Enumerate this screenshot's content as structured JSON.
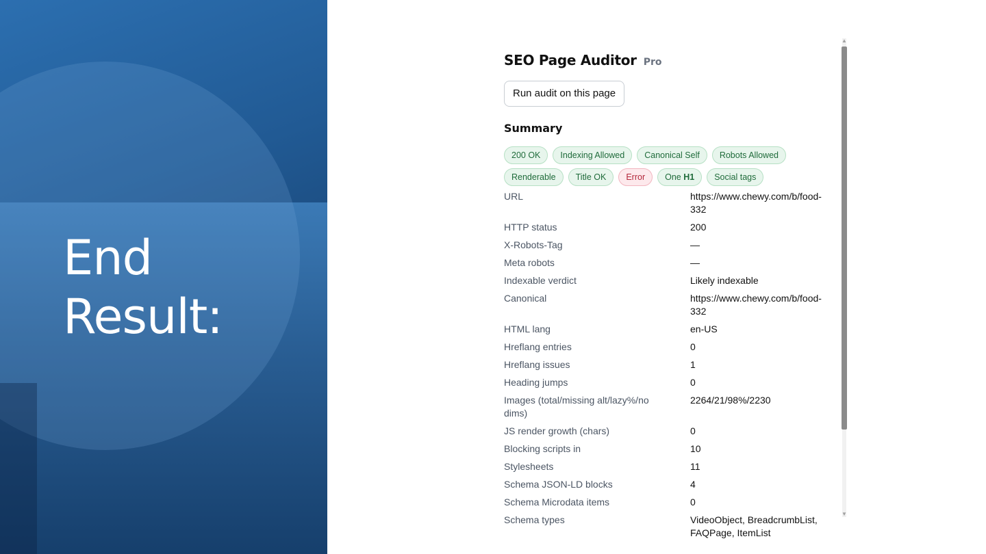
{
  "slide": {
    "title_line1": "End",
    "title_line2": "Result:"
  },
  "extension": {
    "app_name": "SEO Page Auditor",
    "badge": "Pro",
    "run_button_label": "Run audit on this page",
    "summary_heading": "Summary",
    "chips": [
      {
        "label": "200 OK",
        "status": "ok"
      },
      {
        "label": "Indexing Allowed",
        "status": "ok"
      },
      {
        "label": "Canonical Self",
        "status": "ok"
      },
      {
        "label": "Robots Allowed",
        "status": "ok"
      },
      {
        "label": "Renderable",
        "status": "ok"
      },
      {
        "label": "Title OK",
        "status": "ok"
      },
      {
        "label": "Error",
        "status": "error"
      },
      {
        "label_prefix": "One ",
        "label_bold": "H1",
        "status": "ok"
      },
      {
        "label": "Social tags",
        "status": "ok"
      }
    ],
    "rows": [
      {
        "key": "URL",
        "value": "https://www.chewy.com/b/food-332"
      },
      {
        "key": "HTTP status",
        "value": "200"
      },
      {
        "key": "X-Robots-Tag",
        "value": "—"
      },
      {
        "key": "Meta robots",
        "value": "—"
      },
      {
        "key": "Indexable verdict",
        "value": "Likely indexable"
      },
      {
        "key": "Canonical",
        "value": "https://www.chewy.com/b/food-332"
      },
      {
        "key": "HTML lang",
        "value": "en-US"
      },
      {
        "key": "Hreflang entries",
        "value": "0"
      },
      {
        "key": "Hreflang issues",
        "value": "1"
      },
      {
        "key": "Heading jumps",
        "value": "0"
      },
      {
        "key": "Images (total/missing alt/lazy%/no dims)",
        "value": "2264/21/98%/2230"
      },
      {
        "key": "JS render growth (chars)",
        "value": "0"
      },
      {
        "key": "Blocking scripts in",
        "value": "10"
      },
      {
        "key": "Stylesheets",
        "value": "11"
      },
      {
        "key": "Schema JSON-LD blocks",
        "value": "4"
      },
      {
        "key": "Schema Microdata items",
        "value": "0"
      },
      {
        "key": "Schema types",
        "value": "VideoObject, BreadcrumbList, FAQPage, ItemList"
      }
    ]
  },
  "colors": {
    "chip_ok_bg": "#e7f5ec",
    "chip_ok_text": "#1f6b3a",
    "chip_error_bg": "#fde9ec",
    "chip_error_text": "#b3263a",
    "slide_blue": "#215a94"
  }
}
